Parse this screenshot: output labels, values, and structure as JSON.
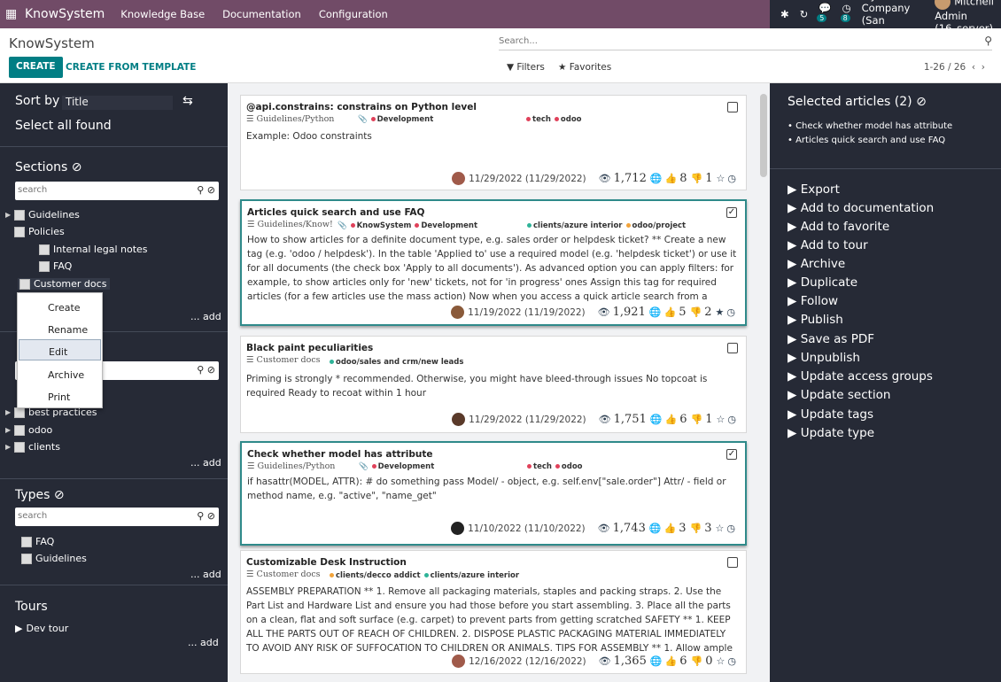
{
  "navbar": {
    "brand": "KnowSystem",
    "menus": [
      "Knowledge Base",
      "Documentation",
      "Configuration"
    ],
    "chat_count": "5",
    "activity_count": "8",
    "company": "My Company (San Francisco)",
    "user": "Mitchell Admin (16_server)"
  },
  "control": {
    "title": "KnowSystem",
    "search_placeholder": "Search...",
    "create": "CREATE",
    "create_template": "CREATE FROM TEMPLATE",
    "filters": "Filters",
    "favorites": "Favorites",
    "pager": "1-26 / 26"
  },
  "left": {
    "sort_by": "Sort by",
    "sort_value": "Title",
    "select_all": "Select all found",
    "sections_title": "Sections",
    "search_placeholder": "search",
    "sections": [
      "Guidelines",
      "Policies",
      "Internal legal notes",
      "FAQ",
      "Customer docs"
    ],
    "add": "... add",
    "tags_items": [
      "best practices",
      "odoo",
      "clients"
    ],
    "types_title": "Types",
    "types": [
      "FAQ",
      "Guidelines"
    ],
    "tours_title": "Tours",
    "tours": [
      "Dev tour"
    ],
    "context_menu": [
      "Create",
      "Rename",
      "Edit",
      "Archive",
      "Print"
    ]
  },
  "articles": [
    {
      "title": "@api.constrains: constrains on Python level",
      "section": "Guidelines/Python",
      "tags1": "Development",
      "tags2": [
        "tech",
        "odoo"
      ],
      "body": "Example: Odoo constraints",
      "date": "11/29/2022 (11/29/2022)",
      "views": "1,712",
      "likes": "8",
      "dislikes": "1"
    },
    {
      "title": "Articles quick search and use FAQ",
      "section": "Guidelines/Know!",
      "tags1": [
        "KnowSystem",
        "Development"
      ],
      "tags2": [
        "clients/azure interior",
        "odoo/project"
      ],
      "body": "How to show articles for a definite document type, e.g. sales order or helpdesk ticket? ** Create a new tag (e.g. 'odoo / helpdesk'). In the table 'Applied to' use a required model (e.g. 'helpdesk ticket') or use it for all documents (the check box 'Apply to all documents'). As advanced option you can apply filters: for example, to show articles only for 'new' tickets, not for 'in progress' ones Assign this tag for required articles (for a few articles use the mass action) Now when you access a quick article search from a document, this tag(s) would be set by default, and",
      "date": "11/19/2022 (11/19/2022)",
      "views": "1,921",
      "likes": "5",
      "dislikes": "2"
    },
    {
      "title": "Black paint peculiarities",
      "section": "Customer docs",
      "tags1": "odoo/sales and crm/new leads",
      "body": "Priming is strongly * recommended. Otherwise, you might have bleed-through issues No topcoat is required Ready to recoat within 1 hour",
      "date": "11/29/2022 (11/29/2022)",
      "views": "1,751",
      "likes": "6",
      "dislikes": "1"
    },
    {
      "title": "Check whether model has attribute",
      "section": "Guidelines/Python",
      "tags1": "Development",
      "tags2": [
        "tech",
        "odoo"
      ],
      "body": "if hasattr(MODEL, ATTR): # do something  pass Model/ - object, e.g. self.env[\"sale.order\"] Attr/ - field or method name, e.g. \"active\", \"name_get\"",
      "date": "11/10/2022 (11/10/2022)",
      "views": "1,743",
      "likes": "3",
      "dislikes": "3"
    },
    {
      "title": "Customizable Desk Instruction",
      "section": "Customer docs",
      "tags1": [
        "clients/decco addict",
        "clients/azure interior"
      ],
      "body": "ASSEMBLY PREPARATION ** 1. Remove all packaging materials, staples and packing straps. 2. Use the Part List and Hardware List and ensure you had those before you start assembling. 3. Place all the parts on a clean, flat and soft surface (e.g. carpet) to prevent parts from getting scratched SAFETY ** 1. KEEP ALL THE PARTS OUT OF REACH OF CHILDREN. 2. DISPOSE PLASTIC PACKAGING MATERIAL IMMEDIATELY TO AVOID ANY RISK OF SUFFOCATION TO CHILDREN OR ANIMALS. TIPS FOR ASSEMBLY ** 1. Allow ample room for assembly and in close proximity to where",
      "date": "12/16/2022 (12/16/2022)",
      "views": "1,365",
      "likes": "6",
      "dislikes": "0"
    }
  ],
  "right": {
    "title": "Selected articles (2)",
    "selected": [
      "Check whether model has attribute",
      "Articles quick search and use FAQ"
    ],
    "actions": [
      "Export",
      "Add to documentation",
      "Add to favorite",
      "Add to tour",
      "Archive",
      "Duplicate",
      "Follow",
      "Publish",
      "Save as PDF",
      "Unpublish",
      "Update access groups",
      "Update section",
      "Update tags",
      "Update type"
    ]
  },
  "colors": {
    "brand": "#714b67",
    "accent": "#017e84",
    "panel": "#262a36",
    "tag_red": "#e0415a",
    "tag_green": "#2eb398",
    "tag_orange": "#f2a33a"
  }
}
